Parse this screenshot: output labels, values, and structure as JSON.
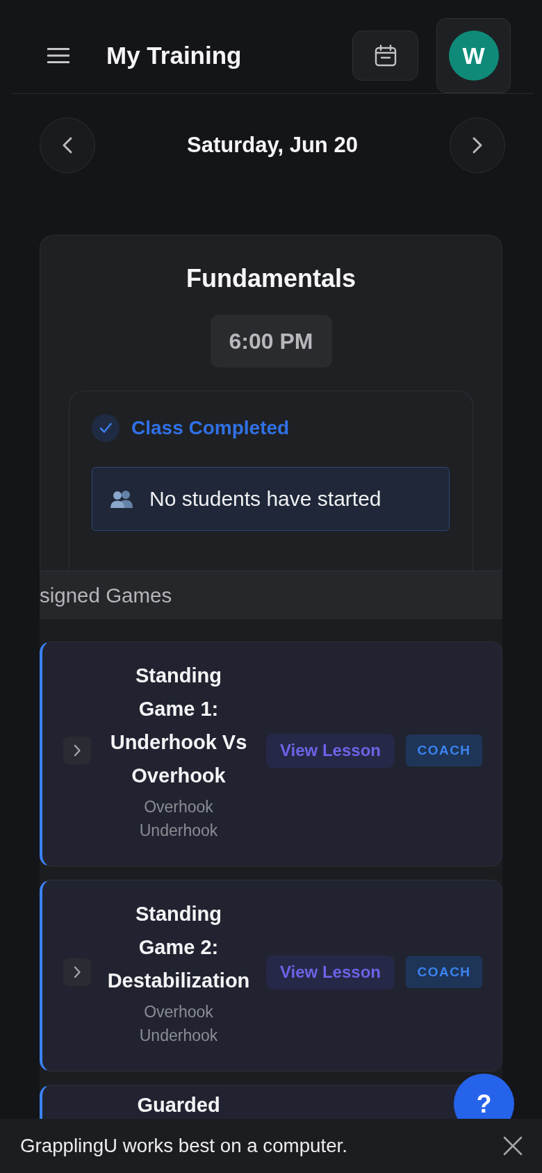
{
  "header": {
    "title": "My Training",
    "avatar_initial": "W"
  },
  "date_nav": {
    "date": "Saturday, Jun 20"
  },
  "class_card": {
    "title": "Fundamentals",
    "time": "6:00 PM",
    "status": "Class Completed",
    "students_message": "No students have started"
  },
  "games_section": {
    "heading": "signed Games",
    "games": [
      {
        "expanded": false,
        "title": "Standing Game 1: Underhook Vs Overhook",
        "tags": [
          "Overhook",
          "Underhook"
        ],
        "action": "View Lesson",
        "badge": "COACH"
      },
      {
        "expanded": false,
        "title": "Standing Game 2: Destabilization",
        "tags": [
          "Overhook",
          "Underhook"
        ],
        "action": "View Lesson",
        "badge": "COACH"
      },
      {
        "title": "Guarded"
      }
    ]
  },
  "help_button": {
    "label": "?"
  },
  "banner": {
    "message": "GrapplingU works best on a computer."
  }
}
